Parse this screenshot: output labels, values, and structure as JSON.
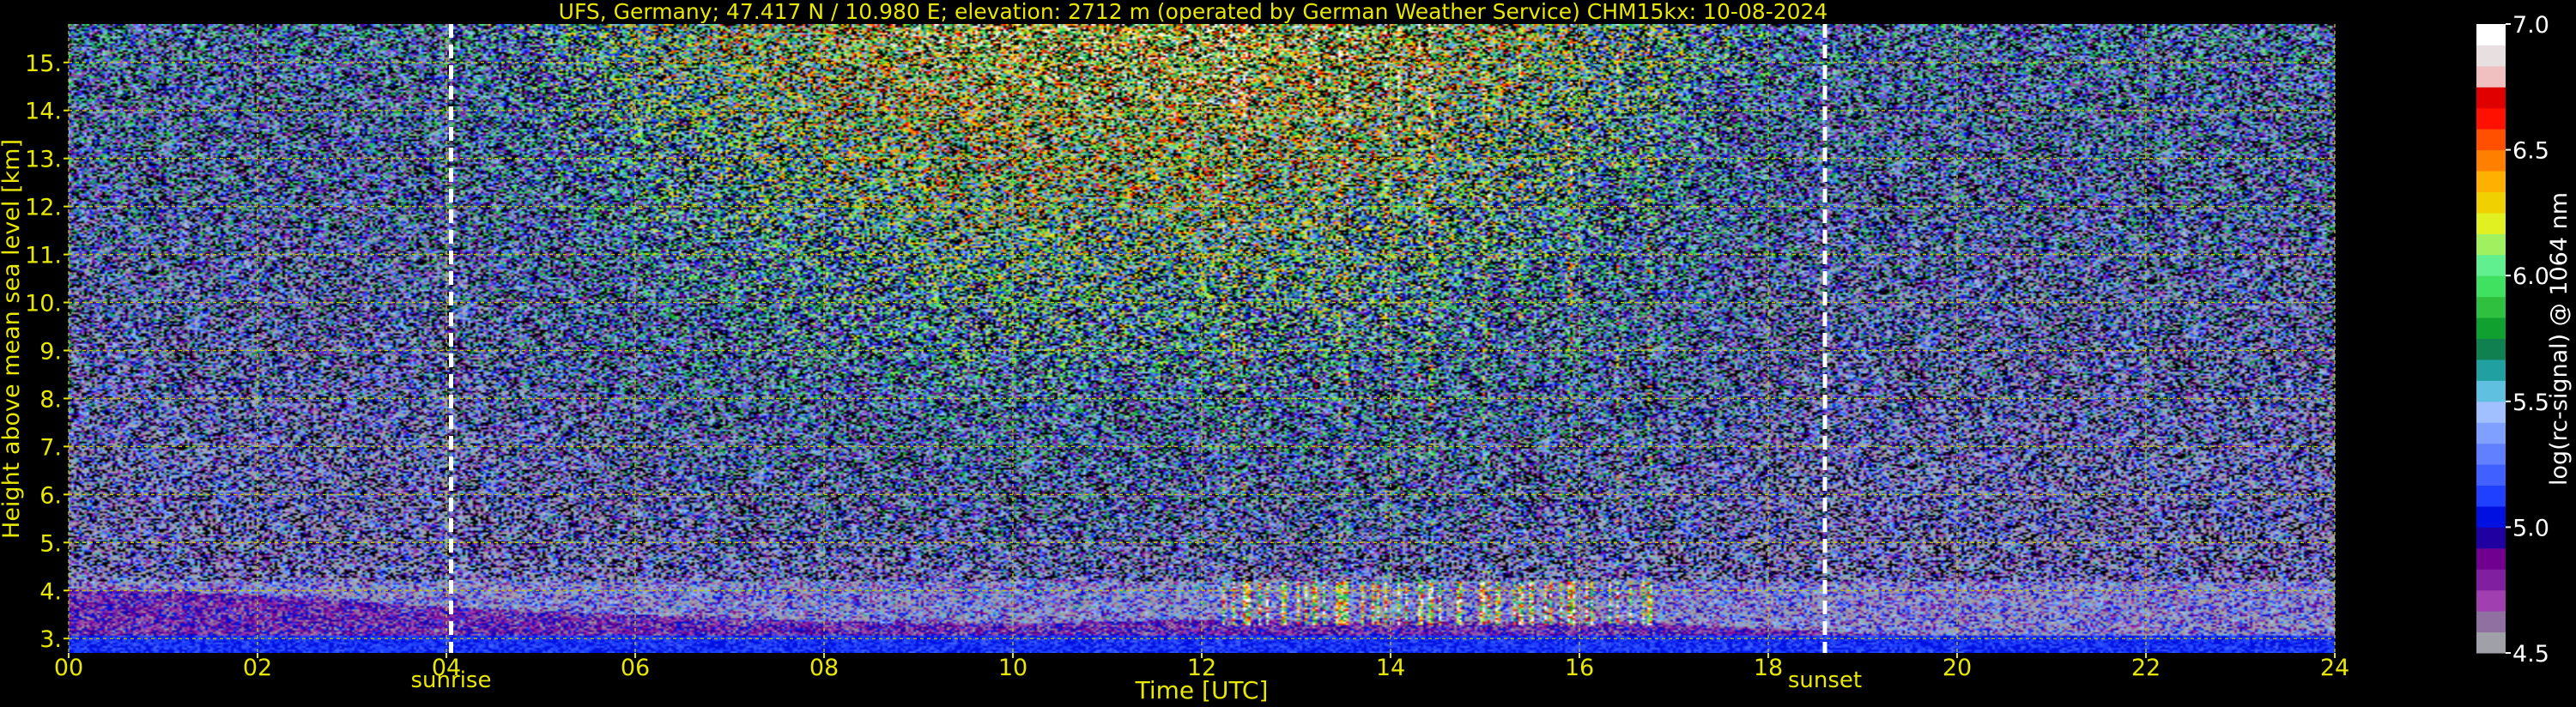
{
  "chart_data": {
    "type": "heatmap",
    "title": "UFS, Germany; 47.417 N / 10.980 E; elevation: 2712 m  (operated by German Weather Service)    CHM15kx: 10-08-2024",
    "xlabel": "Time [UTC]",
    "ylabel": "Height above mean sea level [km]",
    "xlim": [
      0,
      24
    ],
    "ylim": [
      2.7,
      15.8
    ],
    "x_ticks": [
      "00",
      "02",
      "04",
      "06",
      "08",
      "10",
      "12",
      "14",
      "16",
      "18",
      "20",
      "22",
      "24"
    ],
    "y_ticks": [
      "3.",
      "4.",
      "5.",
      "6.",
      "7.",
      "8.",
      "9.",
      "10.",
      "11.",
      "12.",
      "13.",
      "14.",
      "15."
    ],
    "grid": true,
    "markers": [
      {
        "label": "sunrise",
        "x": 4.05
      },
      {
        "label": "sunset",
        "x": 18.6
      }
    ],
    "colorbar": {
      "label": "log(rc-signal) @ 1064 nm",
      "range": [
        4.5,
        7.0
      ],
      "ticks": [
        "4.5",
        "5.0",
        "5.5",
        "6.0",
        "6.5",
        "7.0"
      ],
      "colors": [
        "#a0a0a8",
        "#9070a0",
        "#a040b0",
        "#8020a0",
        "#700090",
        "#2000a0",
        "#0010e0",
        "#2040ff",
        "#4060ff",
        "#6080ff",
        "#80a0ff",
        "#a0c0ff",
        "#60c0e0",
        "#20a0a0",
        "#108050",
        "#10a030",
        "#30c040",
        "#40e060",
        "#60f090",
        "#a0f060",
        "#e0f020",
        "#f0d000",
        "#ffb000",
        "#ff8000",
        "#ff5000",
        "#ff1000",
        "#e00000",
        "#f0c0c0",
        "#e8e0e0",
        "#ffffff"
      ]
    },
    "cloud_base_km": 3.3,
    "cloud_top_km": 4.2,
    "cloud_period_utc": [
      12.2,
      16.9
    ],
    "boundary_layer_top_km": [
      {
        "t": 0,
        "h": 4.05
      },
      {
        "t": 2,
        "h": 3.9
      },
      {
        "t": 4,
        "h": 3.65
      },
      {
        "t": 6,
        "h": 3.5
      },
      {
        "t": 8,
        "h": 3.35
      },
      {
        "t": 10,
        "h": 3.3
      },
      {
        "t": 12,
        "h": 3.4
      },
      {
        "t": 17,
        "h": 3.3
      },
      {
        "t": 18.6,
        "h": 3.15
      },
      {
        "t": 20,
        "h": 3.0
      },
      {
        "t": 24,
        "h": 2.95
      }
    ]
  }
}
